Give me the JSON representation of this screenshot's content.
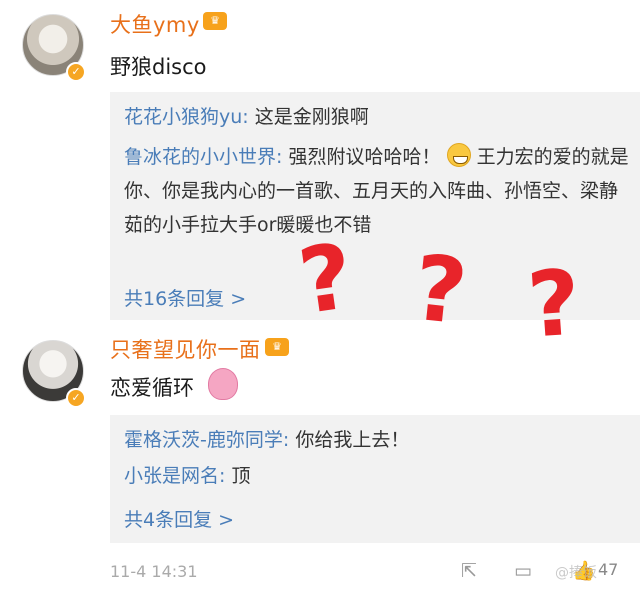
{
  "comments": [
    {
      "username": "大鱼ymy",
      "vip_icon": "vip-crown-icon",
      "text": "野狼disco",
      "replies": [
        {
          "name": "花花小狼狗yu",
          "text": "这是金刚狼啊"
        },
        {
          "name": "鲁冰花的小小世界",
          "text": "强烈附议哈哈哈！",
          "text2": "王力宏的爱的就是你、你是我内心的一首歌、五月天的入阵曲、孙悟空、梁静茹的小手拉大手or暖暖也不错"
        }
      ],
      "more_label": "共16条回复 >"
    },
    {
      "username": "只奢望见你一面",
      "vip_icon": "vip-crown-icon",
      "text": "恋爱循环",
      "replies": [
        {
          "name": "霍格沃茨-鹿弥同学",
          "text": "你给我上去！"
        },
        {
          "name": "小张是网名",
          "text": "顶"
        }
      ],
      "more_label": "共4条回复 >"
    }
  ],
  "overlay": {
    "marks": [
      "?",
      "?",
      "?"
    ],
    "color": "#e8242a"
  },
  "footer": {
    "time": "11-4 14:31",
    "like_count": "47",
    "watermark": "@捧饭"
  },
  "colors": {
    "username": "#e8701a",
    "reply_name": "#4a7db8",
    "reply_bg": "#f2f2f2"
  }
}
